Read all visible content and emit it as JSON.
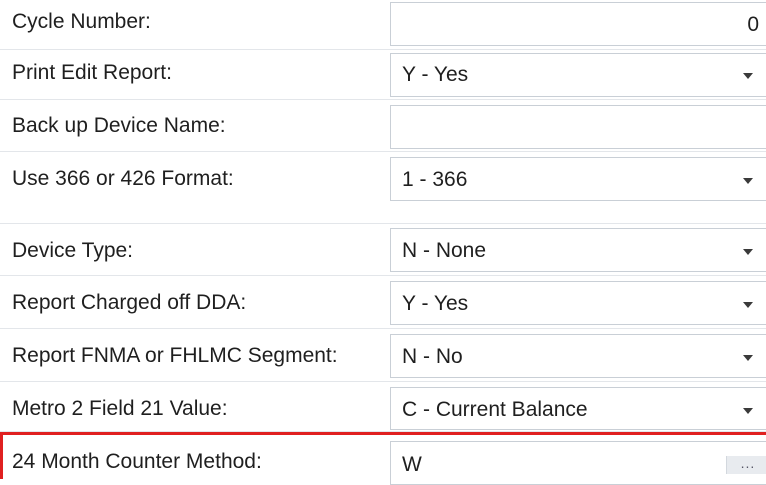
{
  "fields": [
    {
      "label": "Cycle Number:",
      "value": "0",
      "kind": "number"
    },
    {
      "label": "Print Edit Report:",
      "value": "Y - Yes",
      "kind": "select"
    },
    {
      "label": "Back up Device Name:",
      "value": "",
      "kind": "text"
    },
    {
      "label": "Use 366 or 426 Format:",
      "value": "1 - 366",
      "kind": "select"
    },
    {
      "label": "Device Type:",
      "value": "N - None",
      "kind": "select"
    },
    {
      "label": "Report Charged off DDA:",
      "value": "Y - Yes",
      "kind": "select"
    },
    {
      "label": "Report FNMA or FHLMC Segment:",
      "value": "N - No",
      "kind": "select"
    },
    {
      "label": "Metro 2 Field 21 Value:",
      "value": "C - Current Balance",
      "kind": "select"
    },
    {
      "label": "24 Month Counter Method:",
      "value": "W",
      "kind": "lookup"
    }
  ],
  "lookup_button_label": "...",
  "colors": {
    "highlight": "#e02020",
    "field_border": "#c9cfd6"
  },
  "icons": {
    "select": "chevron-down-icon",
    "lookup": "ellipsis-icon"
  }
}
